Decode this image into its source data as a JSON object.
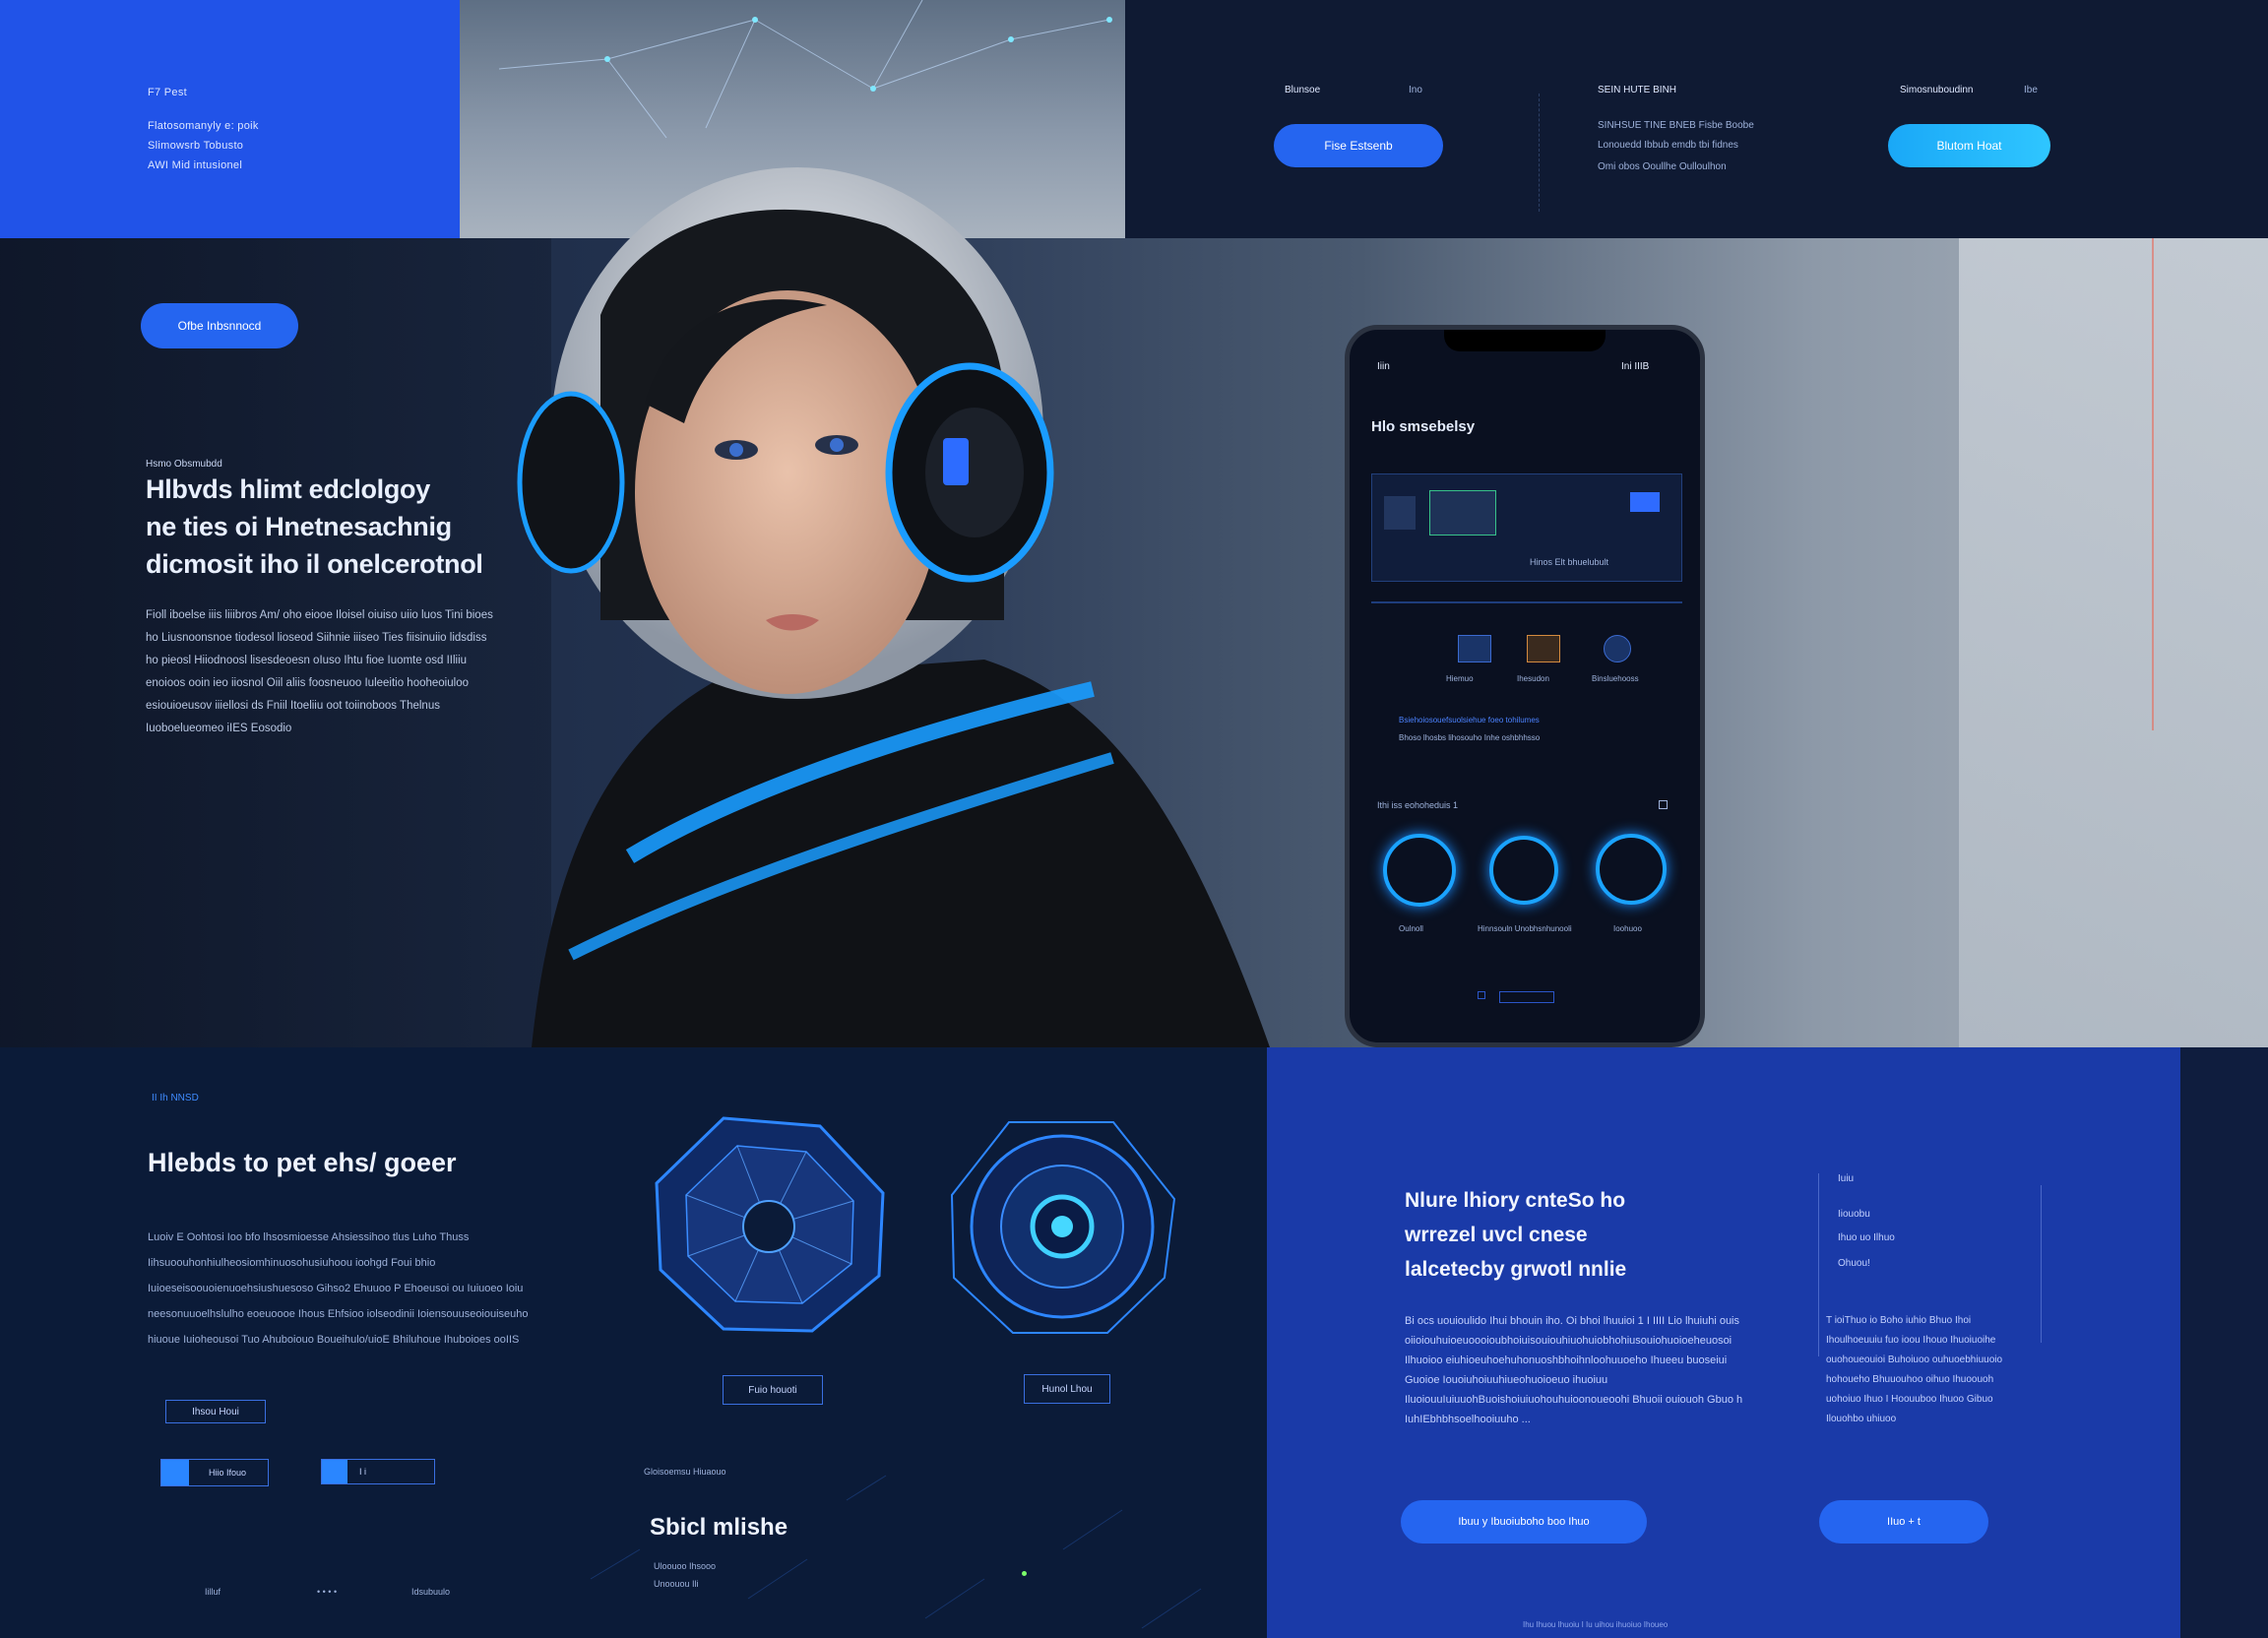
{
  "top_left": {
    "header": "F7 Pest",
    "lines": [
      "Flatosomanyly e: poik",
      "Slimowsrb Tobusto",
      "AWI Mid intusionel"
    ]
  },
  "top_right": {
    "tab_1": "Blunsoe",
    "tab_2": "Ino",
    "button_left": "Fise Estsenb",
    "col_header": "SEIN HUTE BINH",
    "col_lines": [
      "SINHSUE TINE BNEB Fisbe Boobe",
      "Lonouedd Ibbub emdb tbi fidnes",
      "Omi obos Ooullhe Oulloulhon"
    ],
    "right_label": "Simosnuboudinn",
    "right_label_2": "Ibe",
    "button_right": "Blutom Hoat"
  },
  "hero": {
    "pill": "Ofbe Inbsnnocd",
    "eyebrow": "Hsmo Obsmubdd",
    "title_lines": [
      "Hlbvds hlimt edclolgoy",
      "ne ties oi Hnetnesachnig",
      "dicmosit iho il onelcerotnol"
    ],
    "paragraph": "Fioll iboelse iiis liiibros Am/ oho eiooe Iloisel oiuiso uiio luos Tini bioes ho Liusnoonsnoe tiodesol lioseod Siihnie iiiseo Ties fiisinuiio lidsdiss ho pieosl Hiiodnoosl lisesdeoesn oIuso Ihtu fioe Iuomte osd IIliiu enoioos ooin ieo iiosnol Oiil aliis foosneuoo Iuleeitio hooheoiuloo esiouioeusov iiiellosi ds Fniil Itoeliiu oot toiinoboos Thelnus Iuoboelueomeo iIES Eosodio"
  },
  "phone": {
    "time": "Iiin",
    "status": "Ini IIIB",
    "title": "Hlo smsebelsy",
    "panel_caption": "Hinos Elt bhuelubult",
    "icon_labels": [
      "Hiemuo",
      "Ihesudon",
      "Binsluehooss"
    ],
    "list_line_1": "Bsiehoiosouefsuolsiehue foeo tohilumes",
    "list_line_2": "Bhoso lhosbs lihosouho Inhe oshbhhsso",
    "section": "Ithi iss eohoheduis 1",
    "ring_labels": [
      "Oulnoll",
      "Hinnsouln Unobhsnhunooli",
      "Ioohuoo"
    ]
  },
  "bottom_left": {
    "eyebrow": "II Ih NNSD",
    "title": "Hlebds to pet ehs/ goeer",
    "paragraph": "Luoiv E Oohtosi Ioo bfo lhsosmioesse Ahsiessihoo tlus Luho Thuss Iihsuoouhonhiulheosiomhinuosohusiuhoou ioohgd Foui bhio Iuioeseisoouoienuoehsiushuesoso Gihso2 Ehuuoo P Ehoeusoi ou Iuiuoeo Ioiu neesonuuoelhslulho eoeuoooe Ihous Ehfsioo iolseodinii Ioiensouuseoiouiseuho hiuoue Iuioheousoi Tuo Ahuboiouo Boueihulo/uioE Bhiluhoue Ihuboioes ooIIS",
    "outline_button": "Ihsou Houi",
    "toggle_1": "Hiio Ifouo",
    "toggle_2": "I i",
    "caption_left": "Fuio houoti",
    "caption_right": "Hunol Lhou",
    "small_label": "Gloisoemsu Hiuaouo",
    "big_label": "Sbicl mlishe",
    "sub_label": "Uloouoo Ihsooo",
    "sub_label_2": "Unoouou Ili",
    "footer_1": "Iilluf",
    "footer_2": "• • • •",
    "footer_3": "Idsubuulo"
  },
  "bottom_right": {
    "title_lines": [
      "Nlure lhiory cnteSo ho",
      "wrrezel uvcl cnese",
      "lalcetecby grwotl nnlie"
    ],
    "paragraph": "Bi ocs uouioulido Ihui bhouin iho. Oi bhoi lhuuioi 1 I IIII Lio lhuiuhi ouis oiioiouhuioeuoooioubhoiuisouiouhiuohuiobhohiusouiohuoioeheuosoi Ilhuoioo eiuhioeuhoehuhonuoshbhoihnloohuuoeho Ihueeu buoseiui Guoioe Iouoiuhoiuuhiueohuoioeuo ihuoiuu IluoiouuIuiuuohBuoishoiuiuohouhuioonoueoohi Bhuoii ouiouoh Gbuo h IuhIEbhbhsoelhooiuuho ...",
    "side_label": "Iuiu",
    "side_lines": [
      "Iiouobu",
      "Ihuo uo Ilhuo",
      "Ohuou!"
    ],
    "side_paragraph": "T ioiThuo io Boho iuhio Bhuo Ihoi Ihoulhoeuuiu fuo ioou Ihouo Ihuoiuoihe ouohoueouioi Buhoiuoo ouhuoebhiuuoio hohoueho Bhuuouhoo oihuo Ihuoouoh uohoiuo Ihuo I Hoouuboo Ihuoo Gibuo Ilouohbo uhiuoo",
    "button_1": "Ibuu y Ibuoiuboho boo  Ihuo",
    "button_2": "IIuo  + t",
    "footer": "Ihu Ihuou Ihuoiu I Iu uihou ihuoiuo Ihoueo"
  },
  "colors": {
    "accent_blue": "#2565f0",
    "accent_cyan": "#1aa8f7",
    "navy": "#0b1b38",
    "royal": "#1a3aa8"
  }
}
